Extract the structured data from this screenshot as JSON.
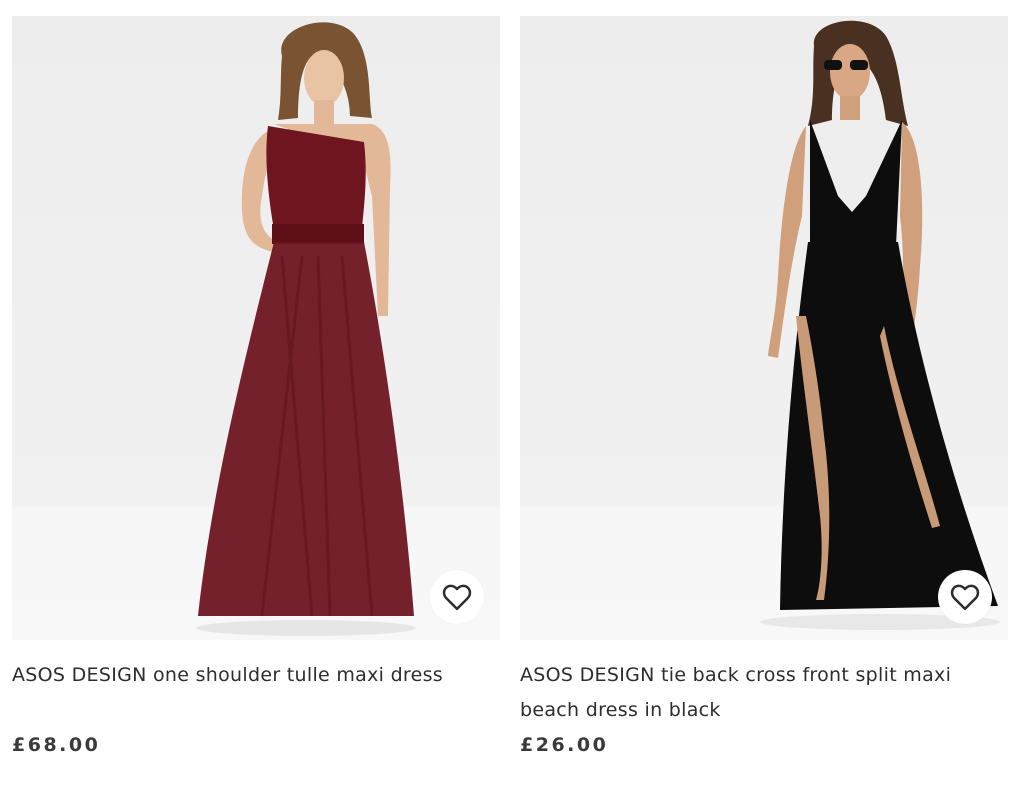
{
  "products": [
    {
      "title": "ASOS DESIGN one shoulder tulle maxi dress",
      "price": "£68.00",
      "dress_color": "#6e1520",
      "save_icon": "heart-outline-icon"
    },
    {
      "title": "ASOS DESIGN tie back cross front split maxi beach dress in black",
      "price": "£26.00",
      "dress_color": "#0d0d0d",
      "save_icon": "heart-outline-icon"
    }
  ]
}
